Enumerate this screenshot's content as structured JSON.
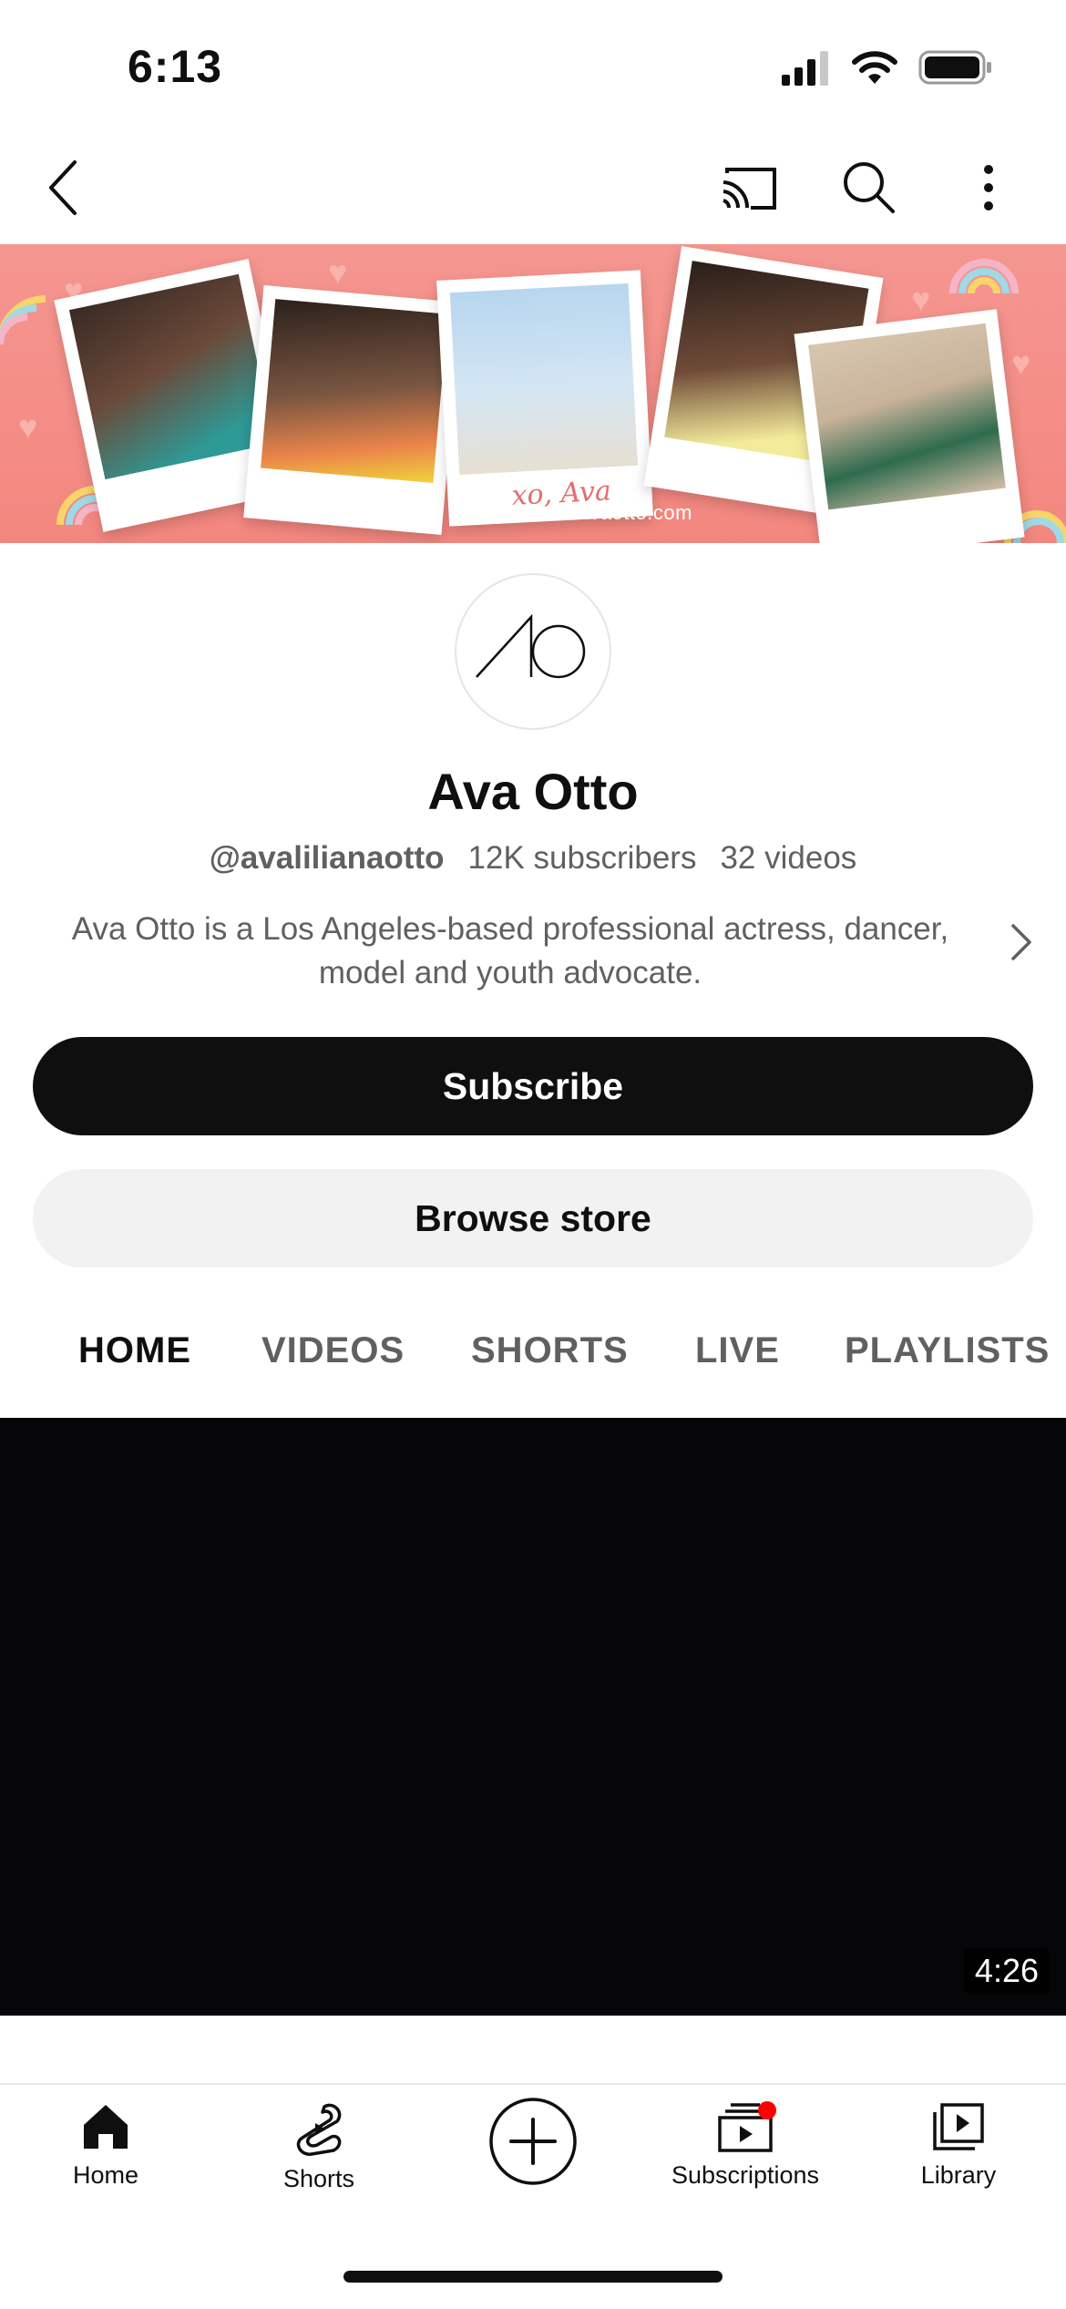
{
  "status_bar": {
    "time": "6:13"
  },
  "channel": {
    "name": "Ava Otto",
    "handle": "@avalilianaotto",
    "subscribers": "12K subscribers",
    "videos": "32 videos",
    "description": "Ava Otto is a Los Angeles-based professional actress, dancer, model and youth advocate.",
    "banner_url_text": "www.avaotto.com",
    "banner_signature": "xo, Ava"
  },
  "buttons": {
    "subscribe": "Subscribe",
    "browse_store": "Browse store"
  },
  "tabs": [
    "HOME",
    "VIDEOS",
    "SHORTS",
    "LIVE",
    "PLAYLISTS"
  ],
  "active_tab": "HOME",
  "video": {
    "duration": "4:26"
  },
  "bottom_nav": {
    "home": "Home",
    "shorts": "Shorts",
    "subscriptions": "Subscriptions",
    "library": "Library"
  },
  "icons": {
    "back": "chevron-left-icon",
    "cast": "cast-icon",
    "search": "search-icon",
    "more": "more-vertical-icon",
    "create": "plus-circle-icon"
  },
  "colors": {
    "banner_bg": "#f3877f",
    "notification_dot": "#ff0000",
    "button_dark": "#0f0f0f",
    "button_light": "#f2f2f2"
  }
}
